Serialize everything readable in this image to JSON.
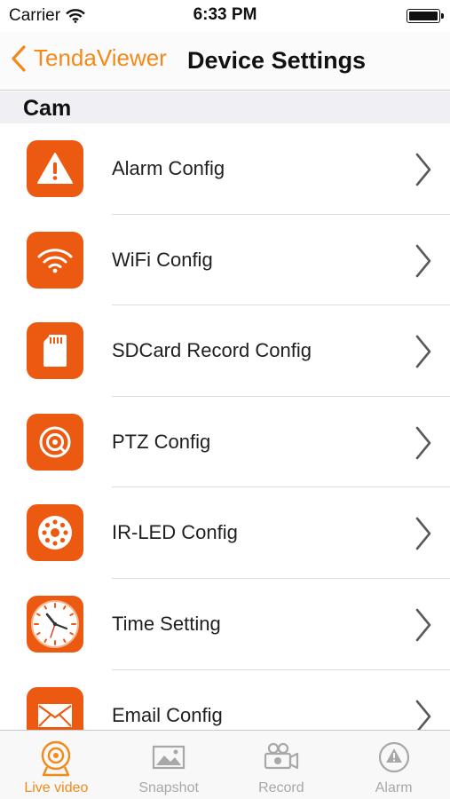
{
  "status_bar": {
    "carrier": "Carrier",
    "time": "6:33 PM"
  },
  "nav": {
    "back_label": "TendaViewer",
    "title": "Device Settings"
  },
  "section": {
    "title": "Cam"
  },
  "items": [
    {
      "label": "Alarm Config",
      "icon": "alarm-warning-icon"
    },
    {
      "label": "WiFi Config",
      "icon": "wifi-icon"
    },
    {
      "label": "SDCard Record Config",
      "icon": "sdcard-icon"
    },
    {
      "label": "PTZ Config",
      "icon": "ptz-icon"
    },
    {
      "label": "IR-LED Config",
      "icon": "ir-led-icon"
    },
    {
      "label": "Time Setting",
      "icon": "clock-icon"
    },
    {
      "label": "Email Config",
      "icon": "email-icon"
    }
  ],
  "tabs": [
    {
      "label": "Live video",
      "icon": "live-video-icon",
      "active": true
    },
    {
      "label": "Snapshot",
      "icon": "snapshot-icon",
      "active": false
    },
    {
      "label": "Record",
      "icon": "record-icon",
      "active": false
    },
    {
      "label": "Alarm",
      "icon": "alarm-icon",
      "active": false
    }
  ],
  "colors": {
    "accent": "#f28a1a",
    "tile": "#ec5a12",
    "tab_inactive": "#a8a8a8"
  }
}
